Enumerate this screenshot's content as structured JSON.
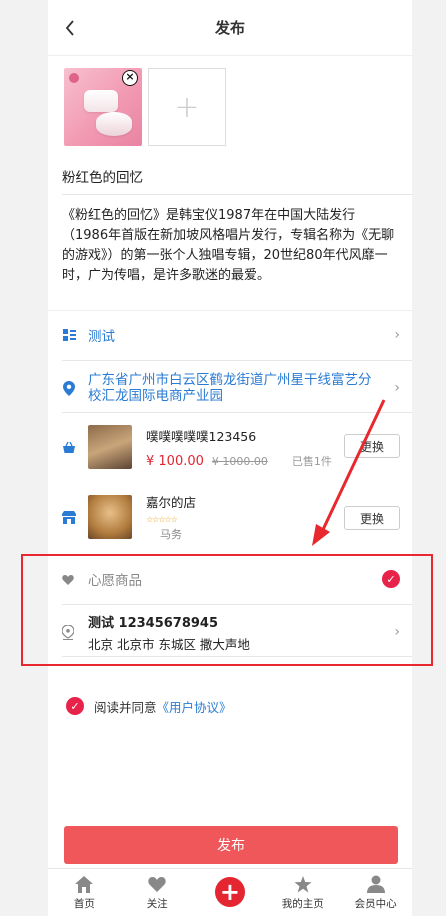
{
  "header": {
    "title": "发布"
  },
  "product": {
    "title": "粉红色的回忆",
    "description": "《粉红色的回忆》是韩宝仪1987年在中国大陆发行（1986年首版在新加坡风格唱片发行，专辑名称为《无聊的游戏》）的第一张个人独唱专辑，20世纪80年代风靡一时，广为传唱，是许多歌迷的最爱。"
  },
  "category": {
    "label": "测试"
  },
  "address_row": {
    "label": "广东省广州市白云区鹤龙街道广州星干线富艺分校汇龙国际电商产业园"
  },
  "goods": {
    "name": "噗噗噗噗噗123456",
    "price": "¥ 100.00",
    "original_price": "¥ 1000.00",
    "sold": "已售1件",
    "change_label": "更换"
  },
  "shop": {
    "name": "嘉尔的店",
    "stars": "☆☆☆☆☆",
    "category": "马务",
    "change_label": "更换"
  },
  "wish": {
    "label": "心愿商品"
  },
  "contact": {
    "name_phone": "测试 12345678945",
    "address": "北京 北京市 东城区 撒大声地"
  },
  "agreement": {
    "prefix": "阅读并同意",
    "link": "《用户协议》"
  },
  "publish_button": "发布",
  "tabs": [
    {
      "label": "首页",
      "icon": "home-icon"
    },
    {
      "label": "关注",
      "icon": "heart-icon"
    },
    {
      "label": "",
      "icon": "plus-icon"
    },
    {
      "label": "我的主页",
      "icon": "star-icon"
    },
    {
      "label": "会员中心",
      "icon": "user-icon"
    }
  ],
  "colors": {
    "accent_blue": "#2a7bd4",
    "red": "#e8234a",
    "publish": "#f0575a",
    "annotation_red": "#e8282e"
  }
}
